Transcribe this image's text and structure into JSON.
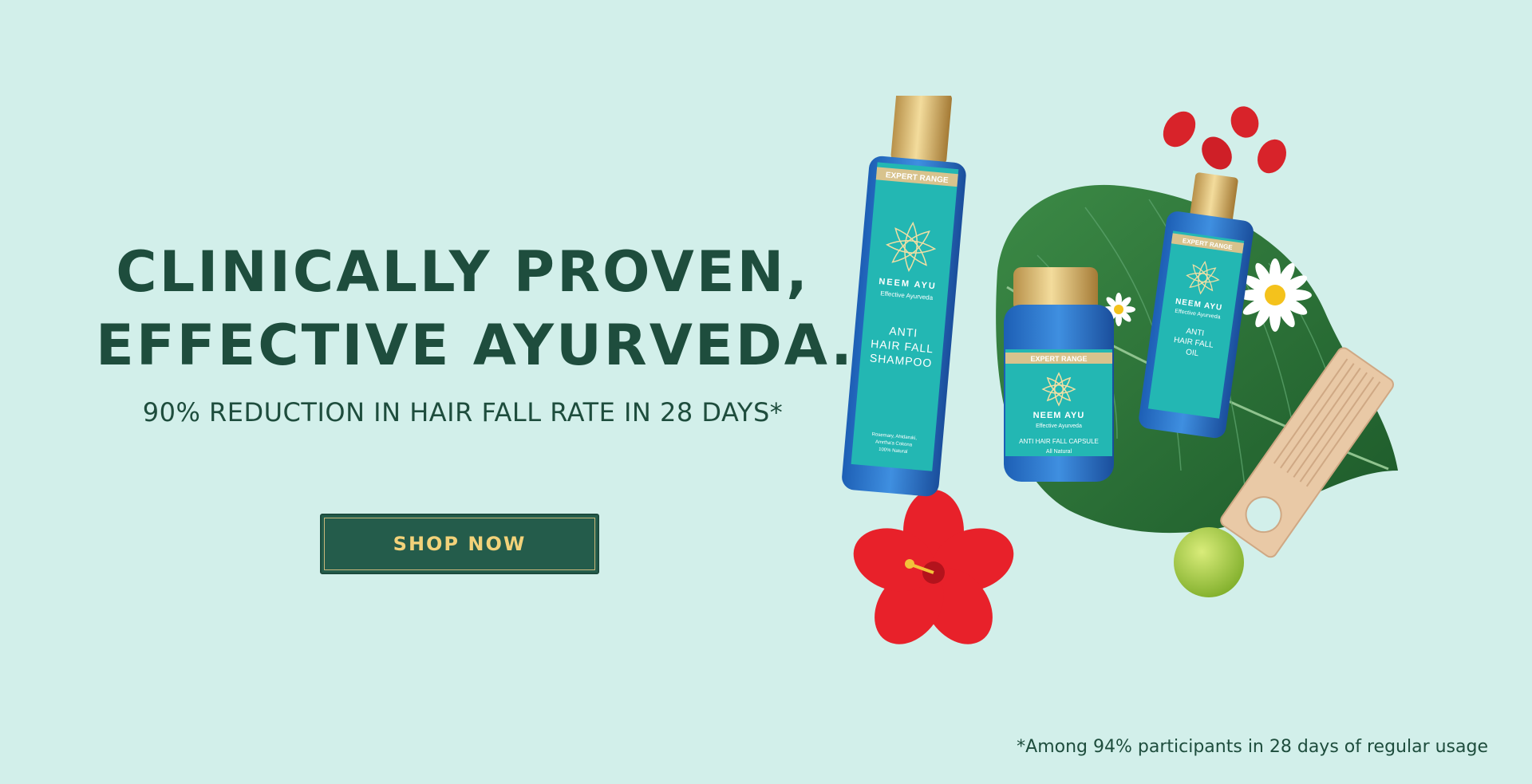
{
  "headline": {
    "line1": "CLINICALLY PROVEN,",
    "line2": "EFFECTIVE AYURVEDA."
  },
  "subheadline": "90% REDUCTION IN HAIR FALL RATE IN 28 DAYS*",
  "cta": {
    "label": "SHOP NOW"
  },
  "disclaimer": "*Among 94% participants in 28 days of regular usage",
  "colors": {
    "background": "#d2efea",
    "text": "#1e4d3d",
    "button": "#245c4b",
    "button_text": "#f2d27a",
    "product_teal": "#20b5b5"
  },
  "products": {
    "shampoo": {
      "badge": "EXPERT RANGE",
      "brand": "NEEM AYU",
      "tagline": "Effective Ayurveda",
      "name_line1": "ANTI",
      "name_line2": "HAIR FALL",
      "name_line3": "SHAMPOO",
      "ingredients_line1": "Rosemary, Ahidaruki,",
      "ingredients_line2": "Amrtha'a Cokona",
      "ingredients_line3": "100% Natural"
    },
    "capsule": {
      "badge": "EXPERT RANGE",
      "brand": "NEEM AYU",
      "tagline": "Effective Ayurveda",
      "name": "ANTI HAIR FALL CAPSULE",
      "sub": "All Natural"
    },
    "oil": {
      "badge": "EXPERT RANGE",
      "brand": "NEEM AYU",
      "tagline": "Effective Ayurveda",
      "name_line1": "ANTI",
      "name_line2": "HAIR FALL",
      "name_line3": "OIL"
    }
  }
}
